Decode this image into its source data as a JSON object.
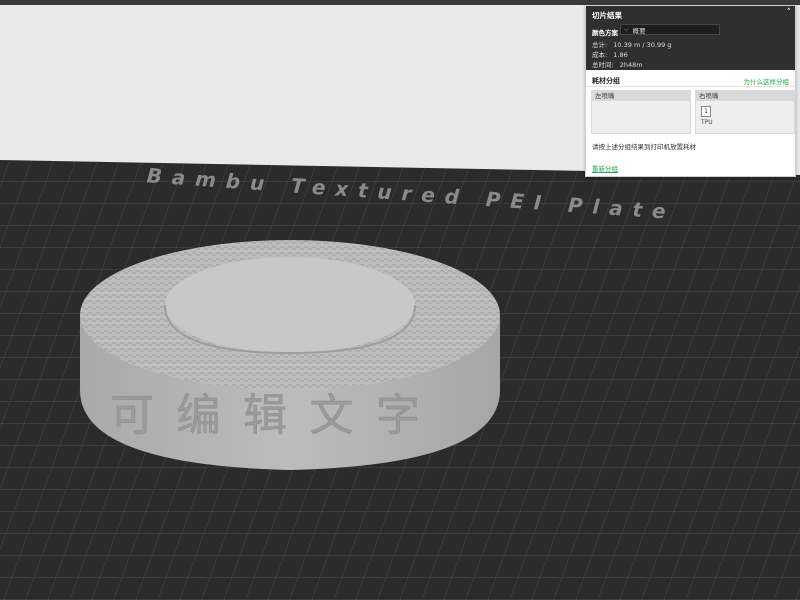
{
  "colors": {
    "accent": "#22a855",
    "plate": "#2a2a2a",
    "model": "#b5b5b5",
    "panel_header": "#2f2f2f"
  },
  "viewport": {
    "plate_label": "Bambu Textured PEI Plate",
    "model_engraving": "可编辑文字"
  },
  "slice_panel": {
    "title": "切片结果",
    "collapse_icon": "chevron-up-icon",
    "color_scheme_label": "颜色方案",
    "color_scheme_value": "概要",
    "total_label": "总计:",
    "total_value": "10.39 m / 30.99 g",
    "cost_label": "成本:",
    "cost_value": "1.86",
    "time_label": "总时间:",
    "time_value": "2h48m"
  },
  "filament_group": {
    "title": "耗材分组",
    "why_link": "为什么这样分组",
    "left_nozzle": "左喷嘴",
    "right_nozzle": "右喷嘴",
    "slot_number": "1",
    "slot_type": "TPU",
    "hint": "请按上述分组结果到打印机放置耗材",
    "regroup": "重新分组"
  }
}
